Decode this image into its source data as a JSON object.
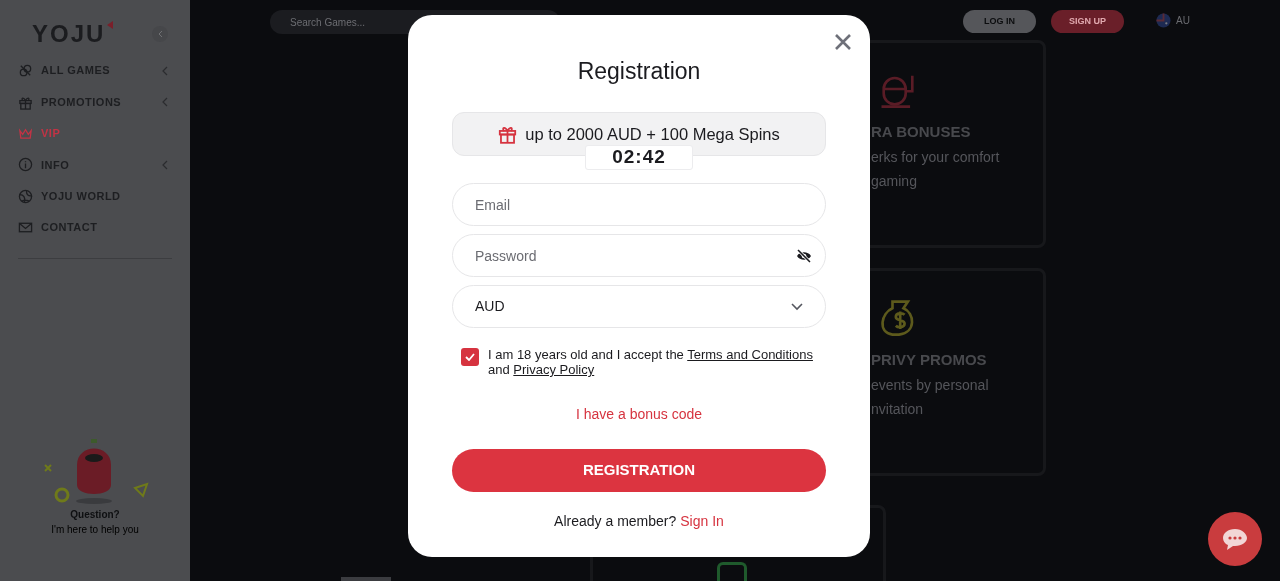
{
  "sidebar": {
    "logo": "YOJU",
    "items": [
      {
        "label": "ALL GAMES",
        "selected": false,
        "expandable": true
      },
      {
        "label": "PROMOTIONS",
        "selected": false,
        "expandable": true
      },
      {
        "label": "VIP",
        "selected": true,
        "expandable": false
      },
      {
        "label": "INFO",
        "selected": false,
        "expandable": true
      },
      {
        "label": "YOJU WORLD",
        "selected": false,
        "expandable": false
      },
      {
        "label": "CONTACT",
        "selected": false,
        "expandable": false
      }
    ],
    "helper": {
      "title": "Question?",
      "subtitle": "I'm here to help you"
    }
  },
  "topbar": {
    "search_placeholder": "Search Games...",
    "login": "LOG IN",
    "signup": "SIGN UP",
    "region": "AU"
  },
  "background_cards": [
    {
      "title": "RA BONUSES",
      "lines": [
        "erks for your comfort",
        "gaming"
      ]
    },
    {
      "title": "PRIVY PROMOS",
      "lines": [
        "events by personal",
        "nvitation"
      ]
    }
  ],
  "modal": {
    "title": "Registration",
    "bonus": {
      "text": "up to 2000 AUD + 100 Mega Spins",
      "timer": "02:42"
    },
    "fields": [
      {
        "kind": "text",
        "placeholder": "Email"
      },
      {
        "kind": "password",
        "placeholder": "Password"
      },
      {
        "kind": "select",
        "value": "AUD"
      }
    ],
    "consent": {
      "checked": true,
      "parts": [
        {
          "kind": "text",
          "text": "I am 18 years old and I accept the "
        },
        {
          "kind": "link",
          "text": "Terms and Conditions"
        },
        {
          "kind": "text",
          "text": " and "
        },
        {
          "kind": "link",
          "text": "Privacy Policy"
        }
      ]
    },
    "bonus_code_link": "I have a bonus code",
    "submit": "REGISTRATION",
    "member_prompt": "Already a member?",
    "signin_link": "Sign In"
  }
}
